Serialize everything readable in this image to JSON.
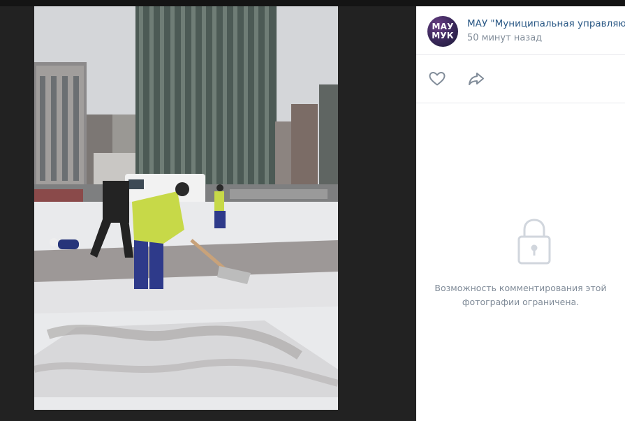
{
  "photo": {
    "alt_icon": "snow-cleaning-photo"
  },
  "author": {
    "name": "МАУ \"Муниципальная управляющая компания\"",
    "avatar_line1": "МАУ",
    "avatar_line2": "МУК",
    "time": "50 минут назад"
  },
  "actions": {
    "like_icon": "heart-icon",
    "share_icon": "share-arrow-icon"
  },
  "comments": {
    "icon": "lock-icon",
    "line1": "Возможность комментирования этой",
    "line2": "фотографии ограничена."
  },
  "colors": {
    "link": "#2a5885",
    "muted": "#818c99",
    "background": "#222222"
  }
}
